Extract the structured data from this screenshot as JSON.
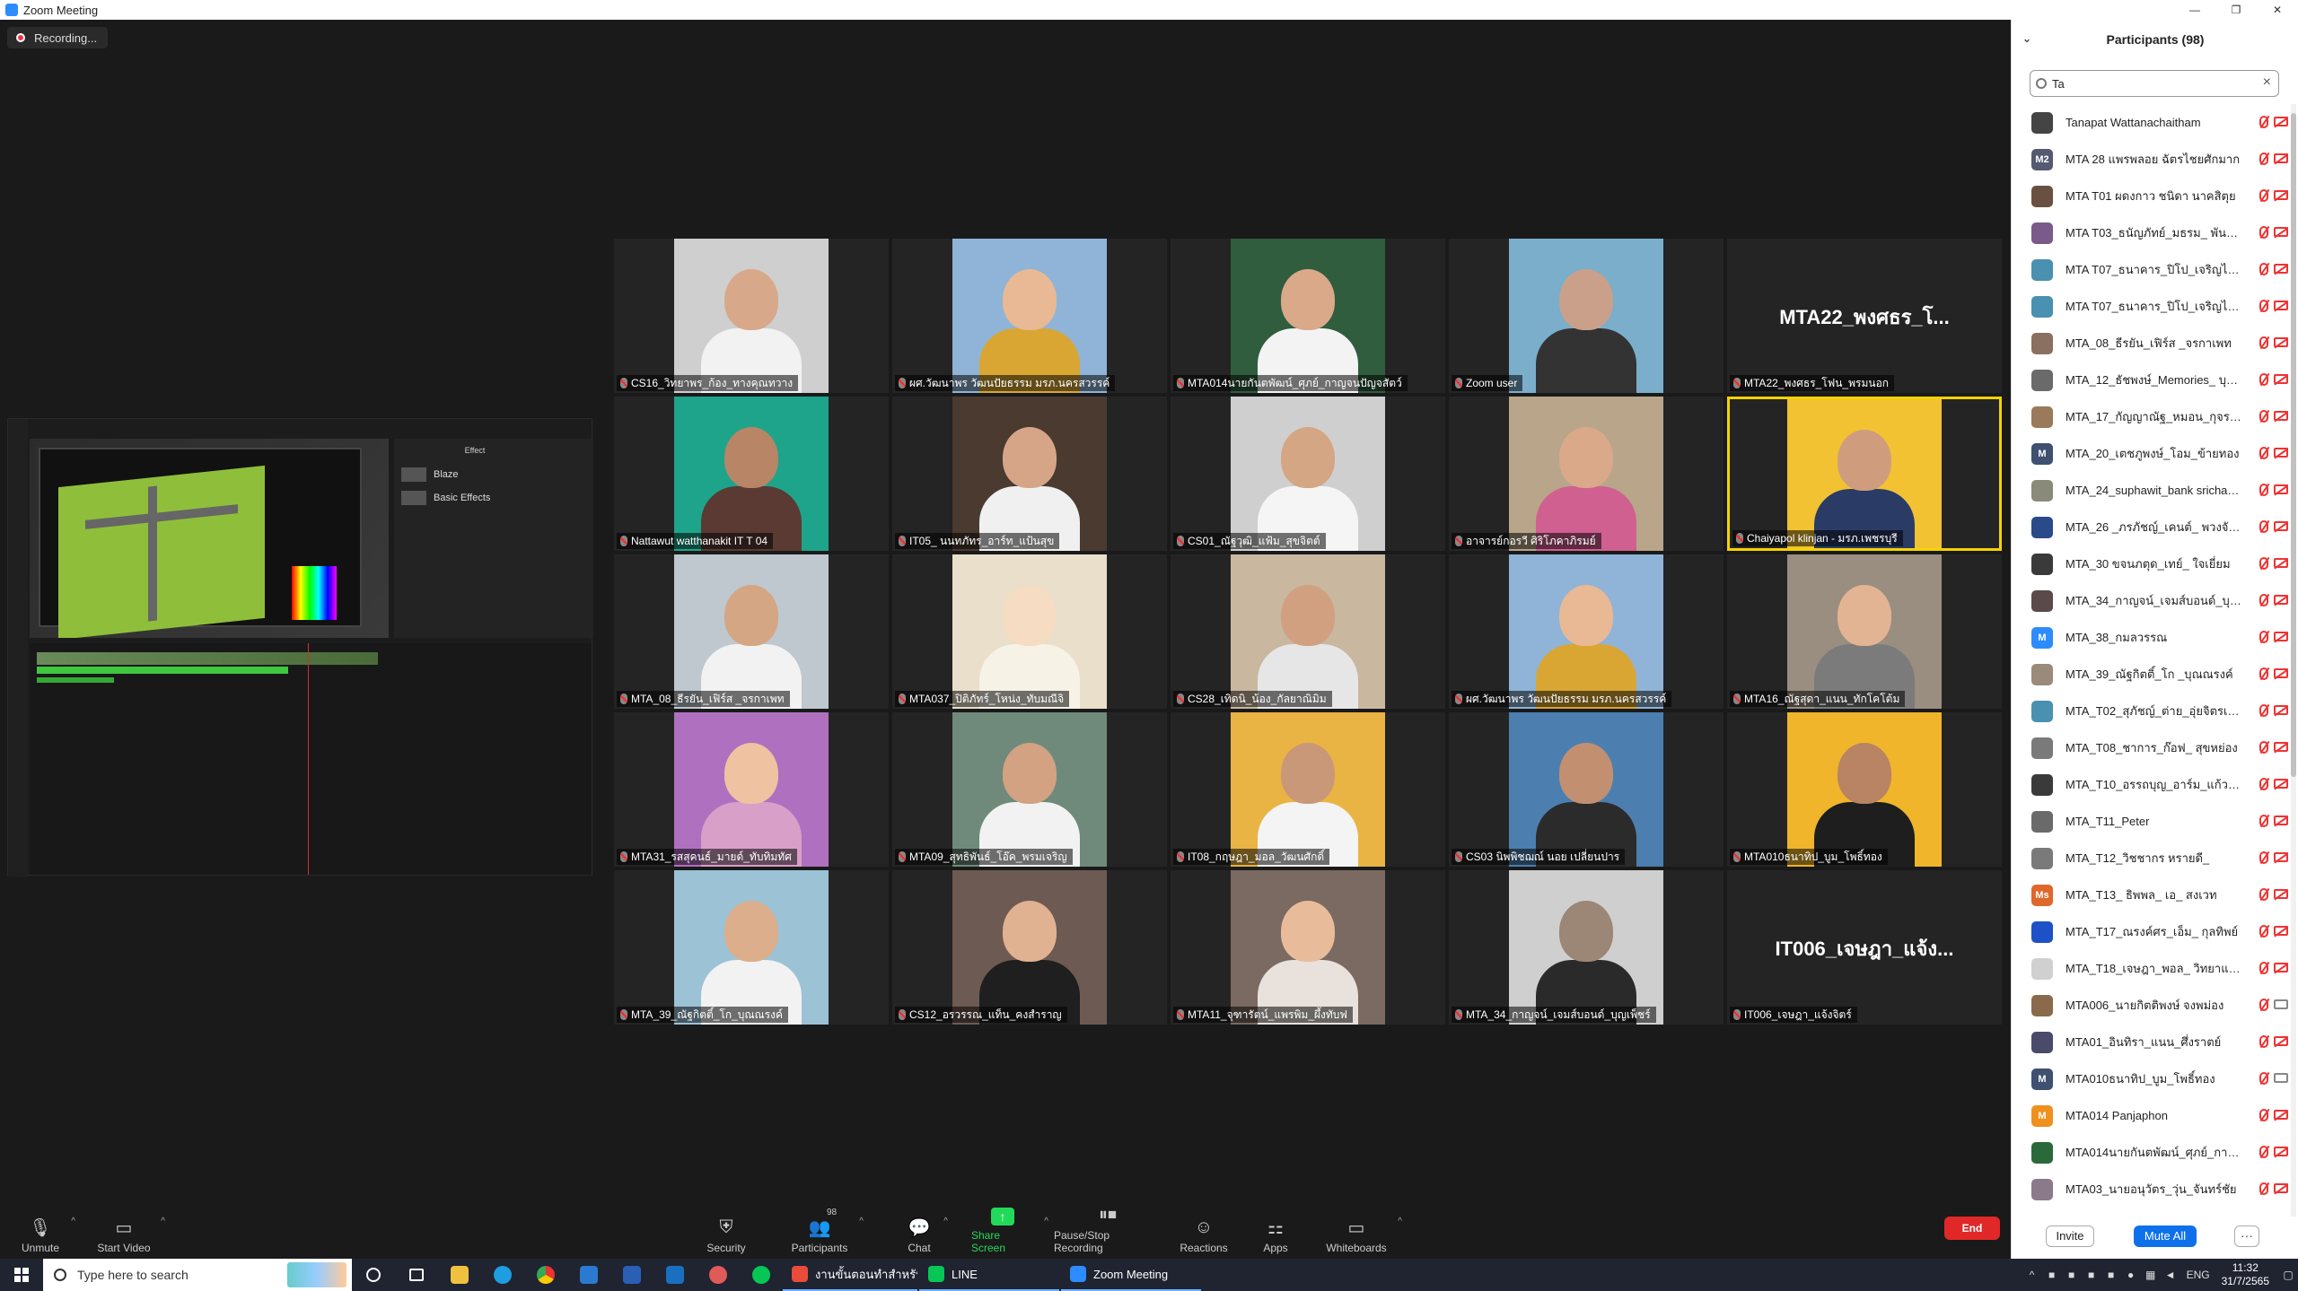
{
  "window": {
    "title": "Zoom Meeting",
    "minimize": "—",
    "restore": "❐",
    "close": "✕"
  },
  "recording": {
    "label": "Recording..."
  },
  "shared_screen": {
    "effect_title": "Effect",
    "effects": [
      "Blaze",
      "Basic Effects"
    ]
  },
  "gallery": {
    "tiles": [
      {
        "name": "CS16_วิทยาพร_ก้อง_ทางคุณทวาง",
        "skin": "#d7a98a",
        "shirt": "#f2f2f2",
        "bg": "#cfcfcf"
      },
      {
        "name": "ผศ.วัฒนาพร วัฒนปัยธรรม มรภ.นครสวรรค์",
        "skin": "#e8b994",
        "shirt": "#d9a634",
        "bg": "#8fb4d8"
      },
      {
        "name": "MTA014นายกันตพัฒน์_ศุภย์_กาญจนปัญจสัตว์",
        "skin": "#d9a98a",
        "shirt": "#f3f3f3",
        "bg": "#2f5d3e"
      },
      {
        "name": "Zoom user",
        "skin": "#caa08a",
        "shirt": "#333333",
        "bg": "#7aaecb"
      },
      {
        "name": "MTA22_พงศธร_โฟน_พรมนอก",
        "bigname": "MTA22_พงศธร_โ...",
        "video": false
      },
      {
        "name": "Nattawut watthanakit IT T 04",
        "skin": "#b88566",
        "shirt": "#5a3a33",
        "bg": "#1ea48a"
      },
      {
        "name": "IT05_ นนทภัทร_อาร์ท_แป้นสุข",
        "skin": "#d6a588",
        "shirt": "#f0f0f0",
        "bg": "#4a3a30"
      },
      {
        "name": "CS01_ณัฐวุฒิ_แฟ้ม_สุขจิตต์",
        "skin": "#d4a684",
        "shirt": "#f5f5f5",
        "bg": "#cfcfcf"
      },
      {
        "name": "อาจารย์กอรวี ศิริโภคาภิรมย์",
        "skin": "#d9a98a",
        "shirt": "#d06090",
        "bg": "#b9a58a"
      },
      {
        "name": "Chaiyapol klinjan - มรภ.เพชรบุรี",
        "skin": "#cf9d7d",
        "shirt": "#2a3b66",
        "bg": "#f2c233",
        "active": true
      },
      {
        "name": "MTA_08_ธีรยัน_เฟิร์ส _จรกาเพท",
        "skin": "#d4a684",
        "shirt": "#f2f2f2",
        "bg": "#bfc7cf"
      },
      {
        "name": "MTA037_ปิติภัทร์_โหน่ง_ทับมณีจิ",
        "skin": "#f5dcc2",
        "shirt": "#f6f2e6",
        "bg": "#e9dfca"
      },
      {
        "name": "CS28_เทิดนิ_น้อง_กัลยาณิมิม",
        "skin": "#d0a080",
        "shirt": "#e6e6e6",
        "bg": "#c9b7a0"
      },
      {
        "name": "ผศ.วัฒนาพร วัฒนปัยธรรม มรภ.นครสวรรค์",
        "skin": "#e8b994",
        "shirt": "#d9a634",
        "bg": "#8fb4d8"
      },
      {
        "name": "MTA16_ณัฐสุดา_แนน_ทักโคโต้ม",
        "skin": "#e3b493",
        "shirt": "#7b7b7b",
        "bg": "#9a8e80"
      },
      {
        "name": "MTA31_รสสุคนธ์_มายด์_ทับทิมทัศ",
        "skin": "#efc2a2",
        "shirt": "#d8a0c8",
        "bg": "#b070c0"
      },
      {
        "name": "MTA09_สุทธิพันธ์_โอ๊ค_พรมเจริญ",
        "skin": "#d2a282",
        "shirt": "#f2f2f2",
        "bg": "#6f8a7a"
      },
      {
        "name": "IT08_กฤษฎา_มอล_วัฒนศักดิ์",
        "skin": "#c99878",
        "shirt": "#f4f4f4",
        "bg": "#e9b443"
      },
      {
        "name": "CS03 นิพพิชฌณ์ นอย เปลี่ยนปาร",
        "skin": "#c29070",
        "shirt": "#2b2b2b",
        "bg": "#4c7fb0"
      },
      {
        "name": "MTA010ธนาทิป_บูม_โพธิ์ทอง",
        "skin": "#b88463",
        "shirt": "#1e1e1e",
        "bg": "#f0b52a"
      },
      {
        "name": "MTA_39_ณัฐกิตติ์_โก_บุณณรงค์",
        "skin": "#dcae8c",
        "shirt": "#f2f2f2",
        "bg": "#9cc2d6"
      },
      {
        "name": "CS12_อรวรรณ_แท็น_คงสำราญ",
        "skin": "#e1b291",
        "shirt": "#1f1f1f",
        "bg": "#6d5a52"
      },
      {
        "name": "MTA11_จุฑารัตน์_แพรพิม_ผึ้งทับฟ",
        "skin": "#e8bc9a",
        "shirt": "#e9e1dc",
        "bg": "#7a6a62"
      },
      {
        "name": "MTA_34_กาญจน์_เจมส์บอนด์_บุญเพ็ชร์",
        "skin": "#9c8676",
        "shirt": "#2a2a2a",
        "bg": "#cfcfcf"
      },
      {
        "name": "IT006_เจษฎา_แจ้งจิตร์",
        "bigname": "IT006_เจษฎา_แจ้ง...",
        "video": false
      }
    ]
  },
  "participants_panel": {
    "title": "Participants (98)",
    "search_value": "Ta",
    "rows": [
      {
        "name": "Tanapat Wattanachaitham",
        "av": "#444",
        "ini": "",
        "cam_on": false
      },
      {
        "name": "MTA 28 แพรพลอย ฉัตรไชยศักมาก",
        "av": "#555a70",
        "ini": "M2",
        "cam_on": false
      },
      {
        "name": "MTA T01 ผดงกาว ชนิดา นาคสิตุย",
        "av": "#6a5040",
        "ini": "",
        "cam_on": false
      },
      {
        "name": "MTA T03_ธนัญภัทย์_มธรม_ พันธุ์ใ...",
        "av": "#7a5a8a",
        "ini": "",
        "cam_on": false
      },
      {
        "name": "MTA T07_ธนาคาร_ปิโป_เจริญไทย",
        "av": "#4a90b0",
        "ini": "",
        "cam_on": false
      },
      {
        "name": "MTA T07_ธนาคาร_ปิโป_เจริญไทย",
        "av": "#4a90b0",
        "ini": "",
        "cam_on": false
      },
      {
        "name": "MTA_08_ธีรยัน_เฟิร์ส _จรกาเพท",
        "av": "#8a7060",
        "ini": "",
        "cam_on": false
      },
      {
        "name": "MTA_12_ธัชพงษ์_Memories_ บุต...",
        "av": "#6a6a6a",
        "ini": "",
        "cam_on": false
      },
      {
        "name": "MTA_17_กัญญาณัฐ_หมอน_กุจรเทศ",
        "av": "#9a7a5a",
        "ini": "",
        "cam_on": false
      },
      {
        "name": "MTA_20_เตชภูพงษ์_โอม_ข้ายทอง",
        "av": "#3f5070",
        "ini": "M",
        "cam_on": false
      },
      {
        "name": "MTA_24_suphawit_bank srichaw...",
        "av": "#8a8a7a",
        "ini": "",
        "cam_on": false
      },
      {
        "name": "MTA_26 _ภรภัชญ์_เคนต์_ พวงจันทร์",
        "av": "#2a4a8a",
        "ini": "",
        "cam_on": false
      },
      {
        "name": "MTA_30 ขจนภตุด_เทย์_ ใจเยี่ยม",
        "av": "#3a3a3a",
        "ini": "",
        "cam_on": false
      },
      {
        "name": "MTA_34_กาญจน์_เจมส์บอนด์_บุญเ...",
        "av": "#5a4a4a",
        "ini": "",
        "cam_on": false
      },
      {
        "name": "MTA_38_กมลวรรณ",
        "av": "#2d8cff",
        "ini": "M",
        "cam_on": false
      },
      {
        "name": "MTA_39_ณัฐกิตติ์_โก _บุณณรงค์",
        "av": "#9a8a7a",
        "ini": "",
        "cam_on": false
      },
      {
        "name": "MTA_T02_สุภัชญ์_ต่าย_อุ่ยจิตรเลศย",
        "av": "#4a90b0",
        "ini": "",
        "cam_on": false
      },
      {
        "name": "MTA_T08_ชาการ_ก๊อฟ_ สุขหย่อง",
        "av": "#7a7a7a",
        "ini": "",
        "cam_on": false
      },
      {
        "name": "MTA_T10_อรรถบุญ_อาร์ม_แก้วตา",
        "av": "#3a3a3a",
        "ini": "",
        "cam_on": false
      },
      {
        "name": "MTA_T11_Peter",
        "av": "#6a6a6a",
        "ini": "",
        "cam_on": false
      },
      {
        "name": "MTA_T12_วิชชากร หรายดี_",
        "av": "#7a7a7a",
        "ini": "",
        "cam_on": false
      },
      {
        "name": "MTA_T13_ ธิพพล_ เอ_ สงเวท",
        "av": "#e0672a",
        "ini": "Ms",
        "cam_on": false
      },
      {
        "name": "MTA_T17_ณรงค์ศร_เอ็ม_ กุลทิพย์",
        "av": "#1e50c8",
        "ini": "",
        "cam_on": false
      },
      {
        "name": "MTA_T18_เจษฎา_พอล_ วิทยาแสรณ์",
        "av": "#d0d0d0",
        "ini": "",
        "cam_on": false
      },
      {
        "name": "MTA006_นายกิตติพงษ์ จงพม่อง",
        "av": "#8a6a4a",
        "ini": "",
        "cam_on": true
      },
      {
        "name": "MTA01_อินทิรา_แนน_ศึ่งราตย์",
        "av": "#4a4a6a",
        "ini": "",
        "cam_on": false
      },
      {
        "name": "MTA010ธนาทิป_บูม_โพธิ์ทอง",
        "av": "#3f5070",
        "ini": "M",
        "cam_on": true
      },
      {
        "name": "MTA014 Panjaphon",
        "av": "#f0901e",
        "ini": "M",
        "cam_on": false
      },
      {
        "name": "MTA014นายกันตพัฒน์_ศุภย์_กาญ...",
        "av": "#2a6a3a",
        "ini": "",
        "cam_on": false
      },
      {
        "name": "MTA03_นายอนุวัตร_วุ่น_จันทร์ชัย",
        "av": "#8a7a8a",
        "ini": "",
        "cam_on": false
      }
    ],
    "invite_label": "Invite",
    "mute_all_label": "Mute All",
    "more_label": "···"
  },
  "toolbar": {
    "unmute": "Unmute",
    "start_video": "Start Video",
    "security": "Security",
    "participants": "Participants",
    "participants_count": "98",
    "chat": "Chat",
    "share_screen": "Share Screen",
    "pause_stop_recording": "Pause/Stop Recording",
    "reactions": "Reactions",
    "apps": "Apps",
    "whiteboards": "Whiteboards",
    "end": "End"
  },
  "taskbar": {
    "search_placeholder": "Type here to search",
    "apps": [
      {
        "label": "งานขั้นตอนทำสำหรับ C...",
        "color": "#e94b3c"
      },
      {
        "label": "LINE",
        "color": "#06c755"
      },
      {
        "label": "Zoom Meeting",
        "color": "#2d8cff"
      }
    ],
    "lang": "ENG",
    "time": "11:32",
    "date": "31/7/2565"
  }
}
